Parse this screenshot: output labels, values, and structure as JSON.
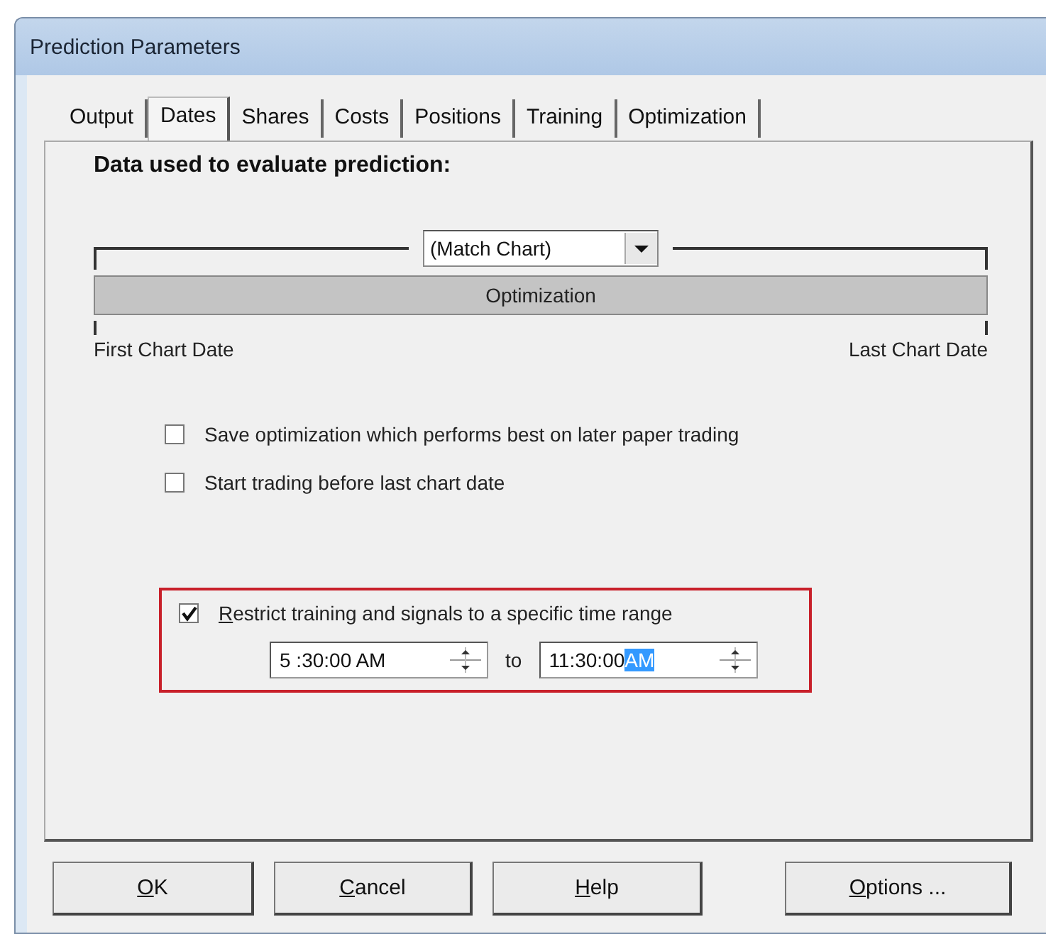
{
  "window": {
    "title": "Prediction Parameters"
  },
  "tabs": [
    {
      "label": "Output",
      "selected": false
    },
    {
      "label": "Dates",
      "selected": true
    },
    {
      "label": "Shares",
      "selected": false
    },
    {
      "label": "Costs",
      "selected": false
    },
    {
      "label": "Positions",
      "selected": false
    },
    {
      "label": "Training",
      "selected": false
    },
    {
      "label": "Optimization",
      "selected": false
    }
  ],
  "heading": "Data used to evaluate prediction:",
  "timeline": {
    "combo": "(Match Chart)",
    "bar": "Optimization",
    "start_label": "First Chart Date",
    "end_label": "Last Chart Date"
  },
  "options": [
    {
      "label": "Save optimization which performs best on later paper trading",
      "checked": false
    },
    {
      "label": "Start trading before last chart date",
      "checked": false
    }
  ],
  "time_range": {
    "label": "Restrict training and signals to a specific time range",
    "checked": true,
    "from": [
      {
        "text": "5 :30:00 AM",
        "selected": false
      }
    ],
    "separator": "to",
    "to": [
      {
        "text": "11:30:00",
        "selected": false
      },
      {
        "text": "AM",
        "selected": true
      }
    ]
  },
  "buttons": [
    "OK",
    "Cancel",
    "Help",
    "Options ..."
  ]
}
